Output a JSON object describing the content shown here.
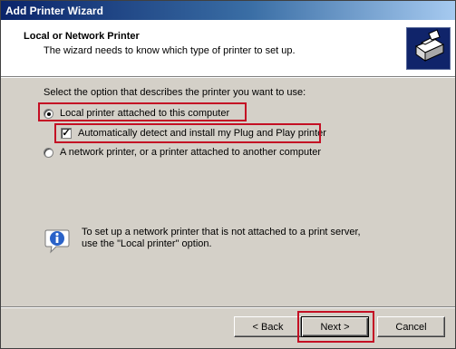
{
  "window": {
    "title": "Add Printer Wizard"
  },
  "header": {
    "title": "Local or Network Printer",
    "subtitle": "The wizard needs to know which type of printer to set up."
  },
  "content": {
    "prompt": "Select the option that describes the printer you want to use:",
    "options": [
      {
        "label": "Local printer attached to this computer",
        "selected": true
      },
      {
        "label": "Automatically detect and install my Plug and Play printer",
        "checked": true,
        "check_mark": "✓"
      },
      {
        "label": "A network printer, or a printer attached to another computer",
        "selected": false
      }
    ],
    "info": {
      "line1": "To set up a network printer that is not attached to a print server,",
      "line2": "use the \"Local printer\" option."
    }
  },
  "buttons": {
    "back": "< Back",
    "next": "Next >",
    "cancel": "Cancel"
  },
  "colors": {
    "highlight": "#c40f24",
    "title_bar_start": "#0a246a",
    "dialog_bg": "#d4d0c8"
  }
}
